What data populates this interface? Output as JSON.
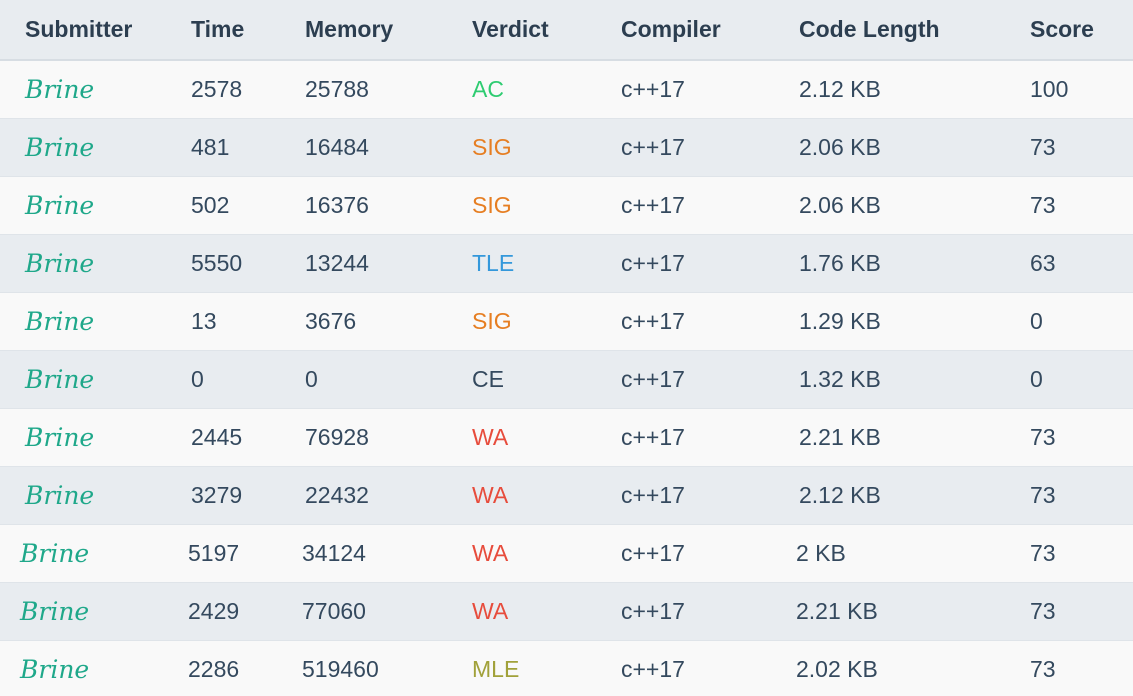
{
  "columns": {
    "submitter": "Submitter",
    "time": "Time",
    "memory": "Memory",
    "verdict": "Verdict",
    "compiler": "Compiler",
    "code_length": "Code Length",
    "score": "Score"
  },
  "verdict_colors": {
    "AC": "#2ecc71",
    "SIG": "#e67e22",
    "TLE": "#3498db",
    "CE": "#34495e",
    "WA": "#e74c3c",
    "MLE": "#a1a13a"
  },
  "submitter_color": "#1fa88a",
  "rows": [
    {
      "submitter": "Brine",
      "time": "2578",
      "memory": "25788",
      "verdict": "AC",
      "compiler": "c++17",
      "code_length": "2.12 KB",
      "score": "100"
    },
    {
      "submitter": "Brine",
      "time": "481",
      "memory": "16484",
      "verdict": "SIG",
      "compiler": "c++17",
      "code_length": "2.06 KB",
      "score": "73"
    },
    {
      "submitter": "Brine",
      "time": "502",
      "memory": "16376",
      "verdict": "SIG",
      "compiler": "c++17",
      "code_length": "2.06 KB",
      "score": "73"
    },
    {
      "submitter": "Brine",
      "time": "5550",
      "memory": "13244",
      "verdict": "TLE",
      "compiler": "c++17",
      "code_length": "1.76 KB",
      "score": "63"
    },
    {
      "submitter": "Brine",
      "time": "13",
      "memory": "3676",
      "verdict": "SIG",
      "compiler": "c++17",
      "code_length": "1.29 KB",
      "score": "0"
    },
    {
      "submitter": "Brine",
      "time": "0",
      "memory": "0",
      "verdict": "CE",
      "compiler": "c++17",
      "code_length": "1.32 KB",
      "score": "0"
    },
    {
      "submitter": "Brine",
      "time": "2445",
      "memory": "76928",
      "verdict": "WA",
      "compiler": "c++17",
      "code_length": "2.21 KB",
      "score": "73"
    },
    {
      "submitter": "Brine",
      "time": "3279",
      "memory": "22432",
      "verdict": "WA",
      "compiler": "c++17",
      "code_length": "2.12 KB",
      "score": "73"
    },
    {
      "submitter": "Brine",
      "time": "5197",
      "memory": "34124",
      "verdict": "WA",
      "compiler": "c++17",
      "code_length": "2 KB",
      "score": "73"
    },
    {
      "submitter": "Brine",
      "time": "2429",
      "memory": "77060",
      "verdict": "WA",
      "compiler": "c++17",
      "code_length": "2.21 KB",
      "score": "73"
    },
    {
      "submitter": "Brine",
      "time": "2286",
      "memory": "519460",
      "verdict": "MLE",
      "compiler": "c++17",
      "code_length": "2.02 KB",
      "score": "73"
    }
  ]
}
